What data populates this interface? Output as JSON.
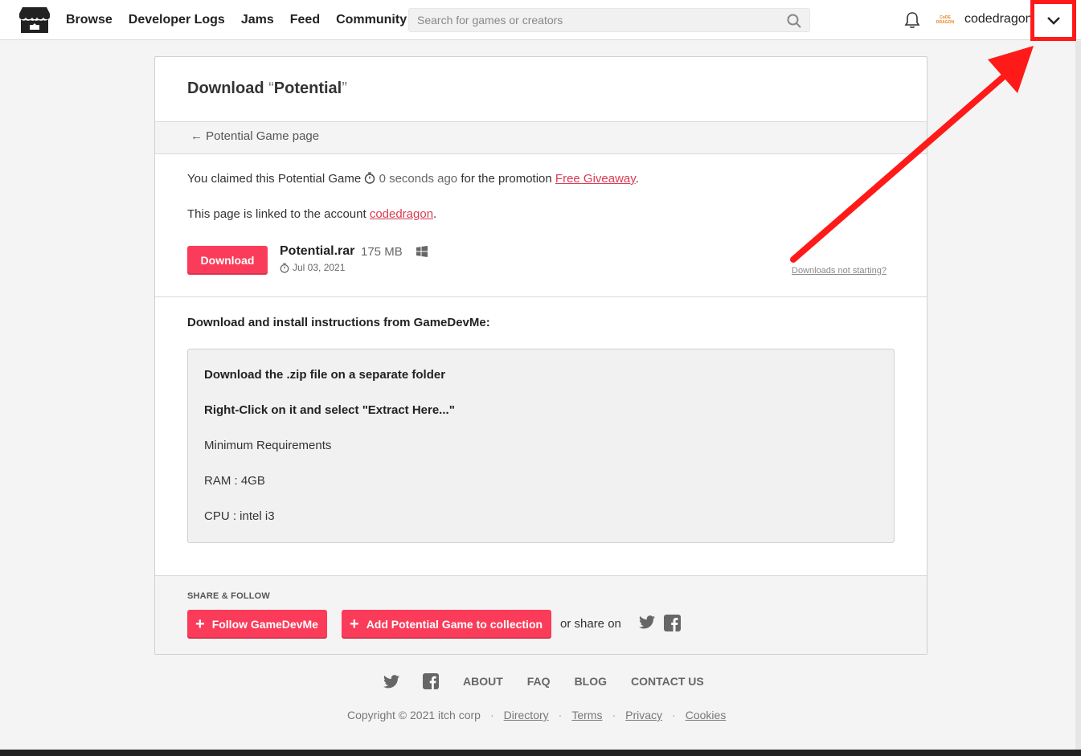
{
  "header": {
    "nav": [
      "Browse",
      "Developer Logs",
      "Jams",
      "Feed",
      "Community"
    ],
    "search_placeholder": "Search for games or creators",
    "avatar_text": [
      "CoDE",
      "DRAGON"
    ],
    "username": "codedragon"
  },
  "card": {
    "title_prefix": "Download ",
    "title_open_quote": "“",
    "title_name": "Potential",
    "title_close_quote": "”",
    "back_link": "← Potential Game page",
    "claimed_prefix": "You claimed this Potential Game",
    "claimed_time": "0 seconds ago",
    "claimed_mid": "for the promotion",
    "promotion": "Free Giveaway",
    "linked_prefix": "This page is linked to the account",
    "linked_account": "codedragon",
    "download_label": "Download",
    "file_name": "Potential.rar",
    "file_size": "175 MB",
    "file_date": "Jul 03, 2021",
    "not_starting": "Downloads not starting?",
    "instructions_heading": "Download and install instructions from GameDevMe:",
    "instructions": [
      "Download the .zip file on a separate folder",
      "Right-Click on it and select \"Extract Here...\"",
      "Minimum Requirements",
      "RAM : 4GB",
      "CPU : intel i3"
    ],
    "share_label": "SHARE & FOLLOW",
    "follow_label": "Follow GameDevMe",
    "collection_label": "Add Potential Game to collection",
    "share_on": "or share on"
  },
  "footer": {
    "links": [
      "ABOUT",
      "FAQ",
      "BLOG",
      "CONTACT US"
    ],
    "copyright": "Copyright © 2021 itch corp",
    "legal": [
      "Directory",
      "Terms",
      "Privacy",
      "Cookies"
    ]
  },
  "colors": {
    "accent": "#fa3c5a",
    "annotation": "#ff1a1a",
    "link": "#d93a53"
  }
}
